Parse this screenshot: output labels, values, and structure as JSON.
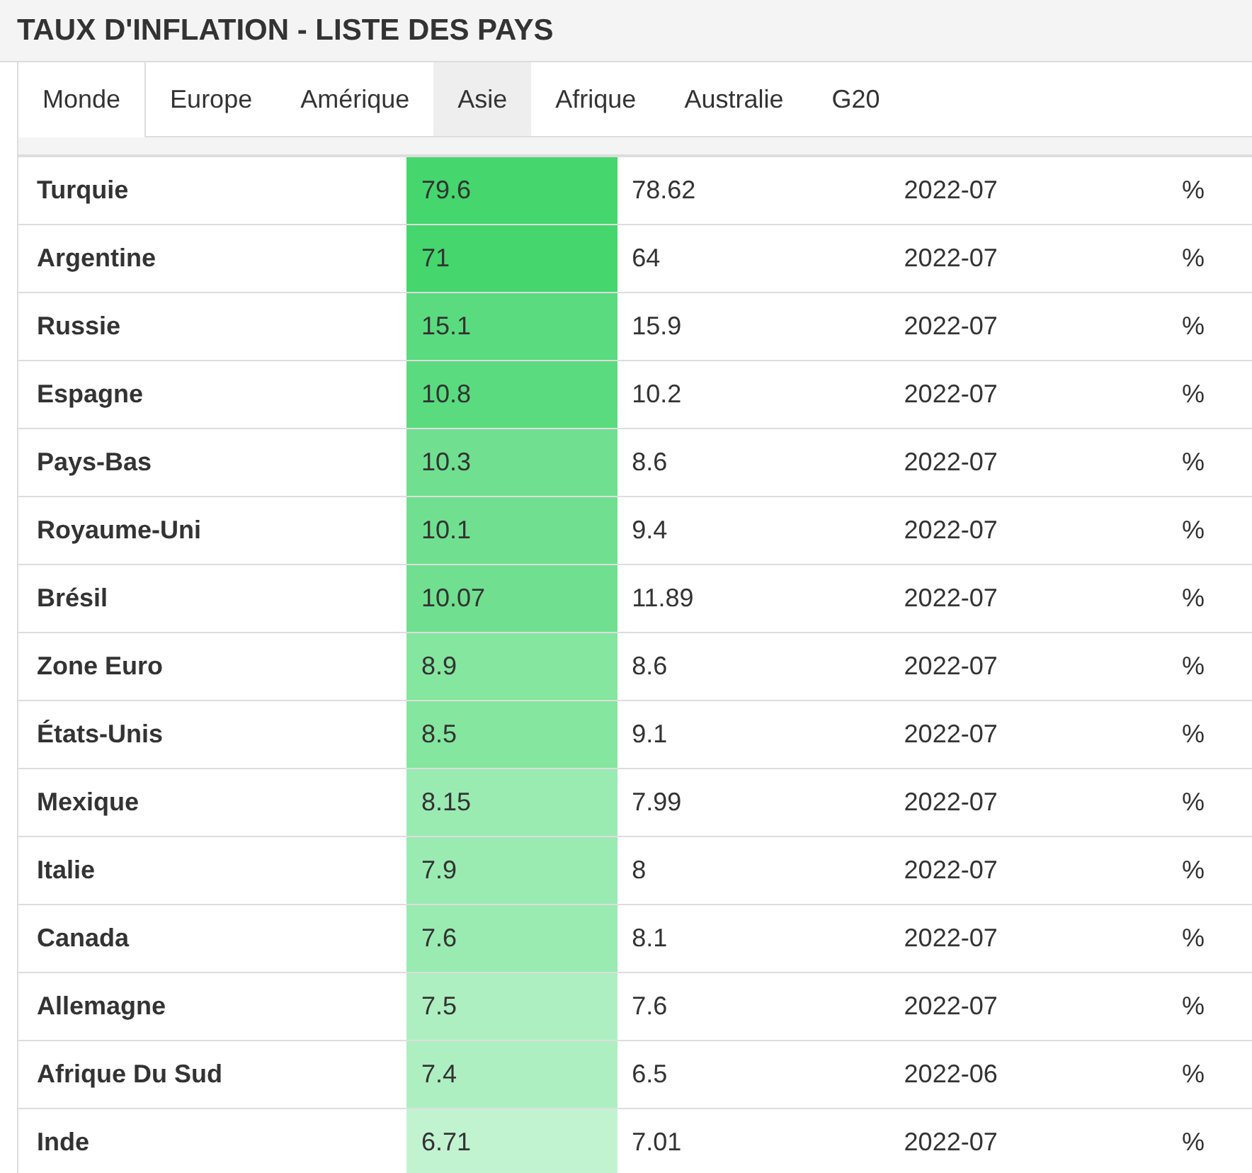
{
  "title": "TAUX D'INFLATION - LISTE DES PAYS",
  "tabs": [
    {
      "label": "Monde",
      "selected": true,
      "hovered": false
    },
    {
      "label": "Europe",
      "selected": false,
      "hovered": false
    },
    {
      "label": "Amérique",
      "selected": false,
      "hovered": false
    },
    {
      "label": "Asie",
      "selected": false,
      "hovered": true
    },
    {
      "label": "Afrique",
      "selected": false,
      "hovered": false
    },
    {
      "label": "Australie",
      "selected": false,
      "hovered": false
    },
    {
      "label": "G20",
      "selected": false,
      "hovered": false
    }
  ],
  "rows": [
    {
      "country": "Turquie",
      "last": "79.6",
      "color": "#45d66e",
      "previous": "78.62",
      "reference": "2022-07",
      "unit": "%"
    },
    {
      "country": "Argentine",
      "last": "71",
      "color": "#45d66e",
      "previous": "64",
      "reference": "2022-07",
      "unit": "%"
    },
    {
      "country": "Russie",
      "last": "15.1",
      "color": "#5bdb7f",
      "previous": "15.9",
      "reference": "2022-07",
      "unit": "%"
    },
    {
      "country": "Espagne",
      "last": "10.8",
      "color": "#5bdb7f",
      "previous": "10.2",
      "reference": "2022-07",
      "unit": "%"
    },
    {
      "country": "Pays-Bas",
      "last": "10.3",
      "color": "#70e090",
      "previous": "8.6",
      "reference": "2022-07",
      "unit": "%"
    },
    {
      "country": "Royaume-Uni",
      "last": "10.1",
      "color": "#70e090",
      "previous": "9.4",
      "reference": "2022-07",
      "unit": "%"
    },
    {
      "country": "Brésil",
      "last": "10.07",
      "color": "#70e090",
      "previous": "11.89",
      "reference": "2022-07",
      "unit": "%"
    },
    {
      "country": "Zone Euro",
      "last": "8.9",
      "color": "#85e6a0",
      "previous": "8.6",
      "reference": "2022-07",
      "unit": "%"
    },
    {
      "country": "États-Unis",
      "last": "8.5",
      "color": "#85e6a0",
      "previous": "9.1",
      "reference": "2022-07",
      "unit": "%"
    },
    {
      "country": "Mexique",
      "last": "8.15",
      "color": "#9aebb2",
      "previous": "7.99",
      "reference": "2022-07",
      "unit": "%"
    },
    {
      "country": "Italie",
      "last": "7.9",
      "color": "#9aebb2",
      "previous": "8",
      "reference": "2022-07",
      "unit": "%"
    },
    {
      "country": "Canada",
      "last": "7.6",
      "color": "#9aebb2",
      "previous": "8.1",
      "reference": "2022-07",
      "unit": "%"
    },
    {
      "country": "Allemagne",
      "last": "7.5",
      "color": "#aeefc1",
      "previous": "7.6",
      "reference": "2022-07",
      "unit": "%"
    },
    {
      "country": "Afrique Du Sud",
      "last": "7.4",
      "color": "#aeefc1",
      "previous": "6.5",
      "reference": "2022-06",
      "unit": "%"
    },
    {
      "country": "Inde",
      "last": "6.71",
      "color": "#c2f3d0",
      "previous": "7.01",
      "reference": "2022-07",
      "unit": "%"
    }
  ]
}
